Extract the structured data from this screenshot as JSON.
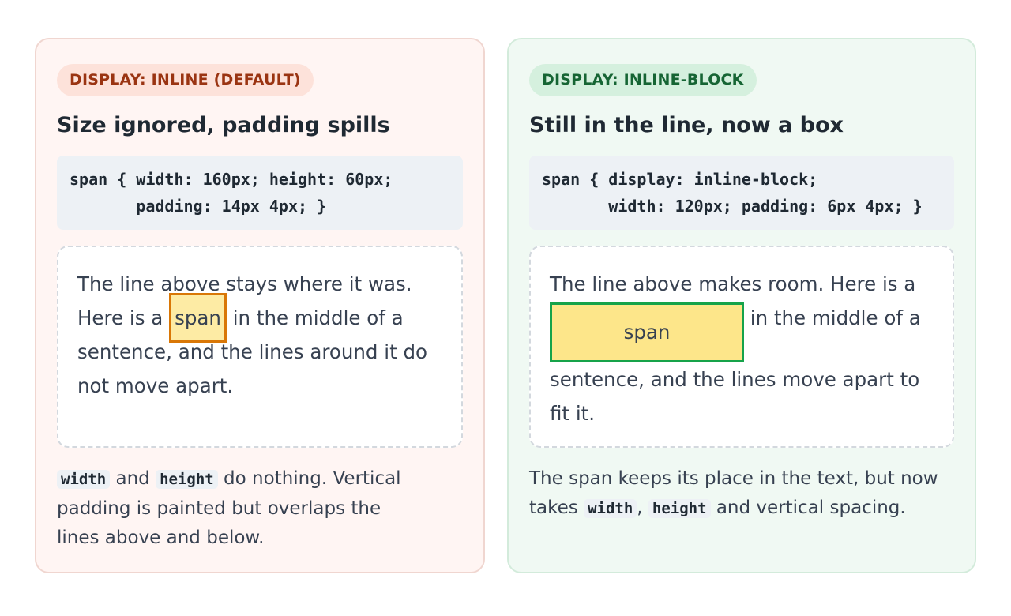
{
  "inline_card": {
    "badge": "DISPLAY: INLINE (DEFAULT)",
    "heading": "Size ignored, padding spills",
    "code_lines": [
      "span { width: 160px; height: 60px;",
      "       padding: 14px 4px; }"
    ],
    "demo": {
      "before": "The line above stays where it was. Here is a ",
      "span_label": "span",
      "after": " in the middle of a sentence, and the lines around it do not move apart."
    },
    "caption": {
      "kw1": "width",
      "text1": " and ",
      "kw2": "height",
      "text2": " do nothing. Vertical padding is painted but overlaps the lines above and below."
    }
  },
  "inline_block_card": {
    "badge": "DISPLAY: INLINE-BLOCK",
    "heading": "Still in the line, now a box",
    "code_lines": [
      "span { display: inline-block;",
      "       width: 120px; padding: 6px 4px; }"
    ],
    "demo": {
      "before": "The line above makes room. Here is a ",
      "span_label": "span",
      "after": " in the middle of a sentence, and the lines move apart to fit it."
    },
    "caption": {
      "text1": "The span keeps its place in the text, but now takes ",
      "kw1": "width",
      "text2": ", ",
      "kw2": "height",
      "text3": " and vertical spacing."
    }
  },
  "colors": {
    "inline_accent": "#d97706",
    "inline_block_accent": "#16a34a",
    "span_fill": "#fde68a"
  }
}
